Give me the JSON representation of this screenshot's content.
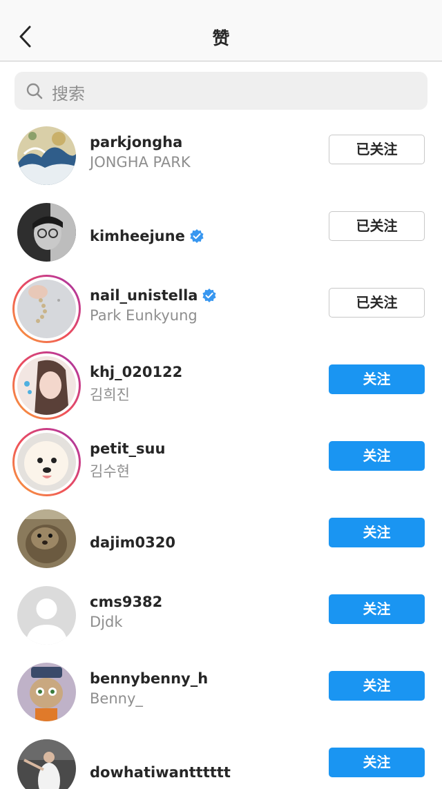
{
  "header": {
    "title": "赞",
    "back_icon": "chevron-left-icon"
  },
  "search": {
    "placeholder": "搜索",
    "icon": "search-icon"
  },
  "colors": {
    "follow_blue": "#1a95f2",
    "verified_blue": "#3897f0",
    "secondary_text": "#8e8e8e"
  },
  "users": [
    {
      "username": "parkjongha",
      "fullname": "JONGHA PARK",
      "verified": false,
      "story": false,
      "button": "已关注"
    },
    {
      "username": "kimheejune",
      "fullname": "",
      "verified": true,
      "story": false,
      "button": "已关注"
    },
    {
      "username": "nail_unistella",
      "fullname": "Park Eunkyung",
      "verified": true,
      "story": true,
      "button": "已关注"
    },
    {
      "username": "khj_020122",
      "fullname": "김희진",
      "verified": false,
      "story": true,
      "button": "关注"
    },
    {
      "username": "petit_suu",
      "fullname": "김수현",
      "verified": false,
      "story": true,
      "button": "关注"
    },
    {
      "username": "dajim0320",
      "fullname": "",
      "verified": false,
      "story": false,
      "button": "关注"
    },
    {
      "username": "cms9382",
      "fullname": "Djdk",
      "verified": false,
      "story": false,
      "button": "关注"
    },
    {
      "username": "bennybenny_h",
      "fullname": "Benny_",
      "verified": false,
      "story": false,
      "button": "关注"
    },
    {
      "username": "dowhatiwantttttt",
      "fullname": "",
      "verified": false,
      "story": false,
      "button": "关注"
    }
  ]
}
